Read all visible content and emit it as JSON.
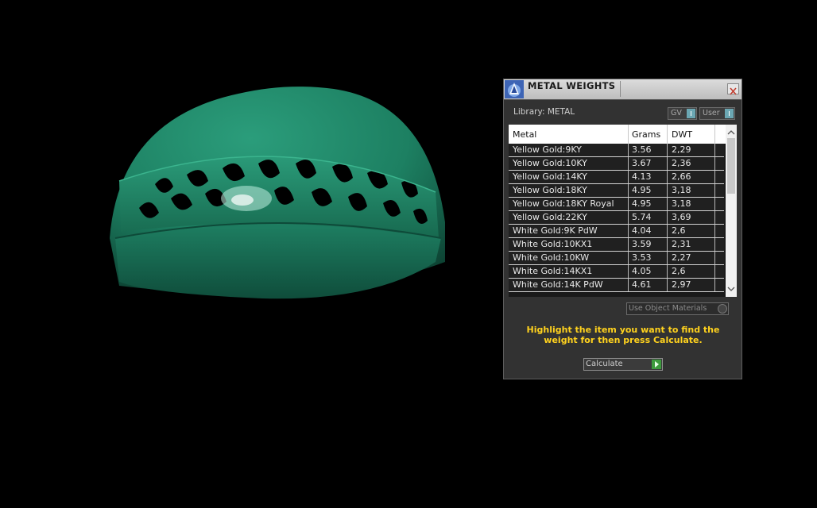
{
  "panel": {
    "title": "METAL WEIGHTS",
    "library_label": "Library: METAL",
    "gv_toggle": "GV",
    "user_toggle": "User",
    "table": {
      "headers": [
        "Metal",
        "Grams",
        "DWT"
      ],
      "rows": [
        {
          "metal": "Yellow Gold:9KY",
          "grams": "3.56",
          "dwt": "2,29"
        },
        {
          "metal": "Yellow Gold:10KY",
          "grams": "3.67",
          "dwt": "2,36"
        },
        {
          "metal": "Yellow Gold:14KY",
          "grams": "4.13",
          "dwt": "2,66"
        },
        {
          "metal": "Yellow Gold:18KY",
          "grams": "4.95",
          "dwt": "3,18"
        },
        {
          "metal": "Yellow Gold:18KY Royal",
          "grams": "4.95",
          "dwt": "3,18"
        },
        {
          "metal": "Yellow Gold:22KY",
          "grams": "5.74",
          "dwt": "3,69"
        },
        {
          "metal": "White Gold:9K PdW",
          "grams": "4.04",
          "dwt": "2,6"
        },
        {
          "metal": "White Gold:10KX1",
          "grams": "3.59",
          "dwt": "2,31"
        },
        {
          "metal": "White Gold:10KW",
          "grams": "3.53",
          "dwt": "2,27"
        },
        {
          "metal": "White Gold:14KX1",
          "grams": "4.05",
          "dwt": "2,6"
        },
        {
          "metal": "White Gold:14K PdW",
          "grams": "4.61",
          "dwt": "2,97"
        }
      ]
    },
    "use_object_materials": "Use Object Materials",
    "instruction": "Highlight the item you want to find the weight for then press Calculate.",
    "calculate_label": "Calculate"
  },
  "colors": {
    "background": "#000000",
    "model": "#1f8a69",
    "instruction_text": "#ffd21e",
    "toggle_accent": "#6ba7b3",
    "calculate_accent": "#3c9b3c"
  },
  "icons": [
    "app-logo-icon",
    "close-icon",
    "scroll-up-icon",
    "scroll-down-icon",
    "toggle-icon",
    "play-arrow-icon"
  ]
}
